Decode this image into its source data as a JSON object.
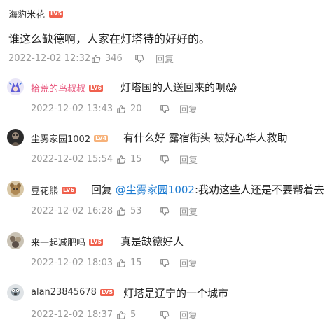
{
  "main_comment": {
    "author": "海豹米花",
    "level": "LV5",
    "text": "谁这么缺德啊，人家在灯塔待的好好的。",
    "date": "2022-12-02 12:32",
    "likes": "346",
    "reply_label": "回复"
  },
  "replies": [
    {
      "author": "拾荒的鸟叔叔",
      "level": "LV6",
      "text": "灯塔国的人送回来的呗😱",
      "date": "2022-12-02 13:43",
      "likes": "20",
      "reply_label": "回复"
    },
    {
      "author": "尘雾家园1002",
      "level": "LV4",
      "text": "有什么好 露宿街头 被好心华人救助",
      "date": "2022-12-02 15:54",
      "likes": "15",
      "reply_label": "回复"
    },
    {
      "author": "豆花熊",
      "level": "LV6",
      "text_prefix": "回复 ",
      "mention": "@尘雾家园1002",
      "text_suffix": ":我劝这些人还是不要帮着去",
      "date": "2022-12-02 16:28",
      "likes": "53",
      "reply_label": "回复"
    },
    {
      "author": "来一起减肥吗",
      "level": "LV5",
      "text": "真是缺德好人",
      "date": "2022-12-02 18:03",
      "likes": "15",
      "reply_label": "回复"
    },
    {
      "author": "alan23845678",
      "level": "LV5",
      "text": "灯塔是辽宁的一个城市",
      "date": "2022-12-02 18:37",
      "likes": "5",
      "reply_label": "回复"
    }
  ],
  "colors": {
    "level_badge": "#f0604d",
    "level_badge_light": "#f7b27a",
    "mention": "#1c7bd1",
    "vip_name": "#e8537a",
    "meta": "#999999"
  },
  "icons": {
    "like": "thumbs-up-icon",
    "dislike": "thumbs-down-icon"
  }
}
